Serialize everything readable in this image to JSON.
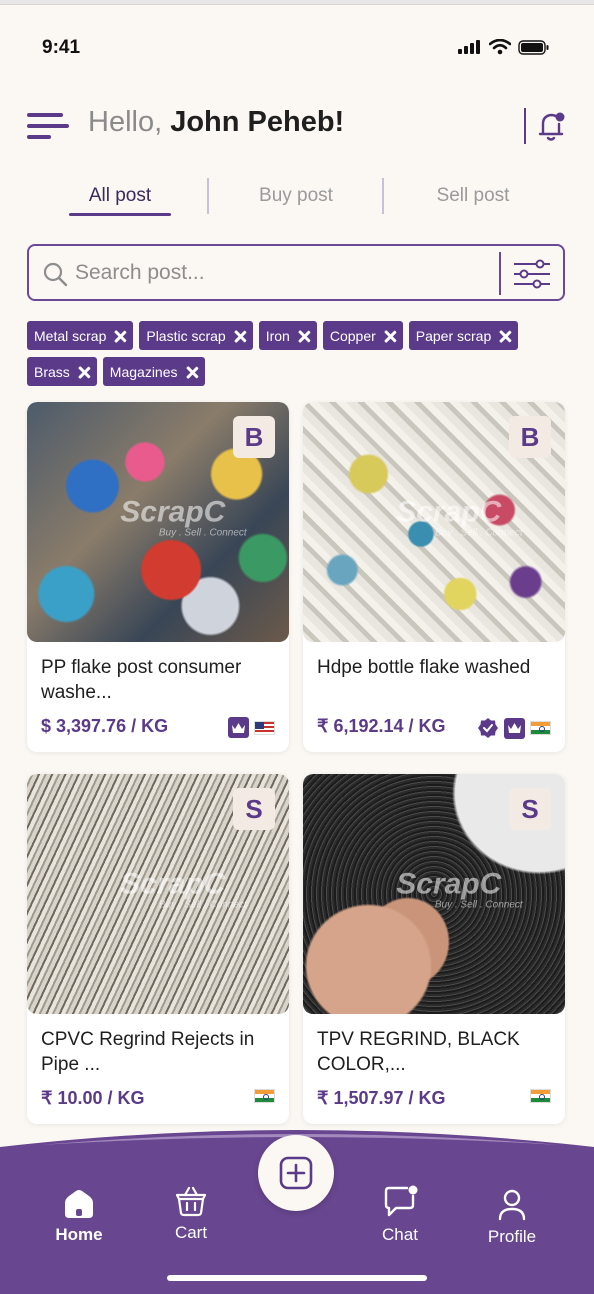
{
  "status_bar": {
    "time": "9:41"
  },
  "header": {
    "greeting_prefix": "Hello, ",
    "user_name": "John Peheb!"
  },
  "tabs": [
    {
      "label": "All post",
      "active": true
    },
    {
      "label": "Buy post",
      "active": false
    },
    {
      "label": "Sell post",
      "active": false
    }
  ],
  "search": {
    "placeholder": "Search post..."
  },
  "filter_chips": [
    "Metal scrap",
    "Plastic scrap",
    "Iron",
    "Copper",
    "Paper scrap",
    "Brass",
    "Magazines"
  ],
  "posts": [
    {
      "title": "PP flake post consumer washe...",
      "price": "$ 3,397.76 / KG",
      "badge": "B",
      "watermark": "ScrapC",
      "watermark_tag": "Buy . Sell . Connect",
      "verified": false,
      "premium": true,
      "flag": "US"
    },
    {
      "title": "Hdpe bottle flake washed",
      "price": "₹ 6,192.14 / KG",
      "badge": "B",
      "watermark": "ScrapC",
      "watermark_tag": "Buy . Sell . Connect",
      "verified": true,
      "premium": true,
      "flag": "IN"
    },
    {
      "title": "CPVC Regrind Rejects in Pipe ...",
      "price": "₹ 10.00 / KG",
      "badge": "S",
      "watermark": "ScrapC",
      "watermark_tag": "Buy . Sell . Connect",
      "verified": false,
      "premium": false,
      "flag": "IN"
    },
    {
      "title": "TPV REGRIND, BLACK COLOR,...",
      "price": "₹ 1,507.97 / KG",
      "badge": "S",
      "watermark": "ScrapC",
      "watermark_tag": "Buy . Sell . Connect",
      "verified": false,
      "premium": false,
      "flag": "IN"
    }
  ],
  "bottom_nav": {
    "home": "Home",
    "cart": "Cart",
    "chat": "Chat",
    "profile": "Profile"
  },
  "colors": {
    "accent": "#5b3a89",
    "background": "#fbf8f4",
    "nav": "#684690"
  }
}
